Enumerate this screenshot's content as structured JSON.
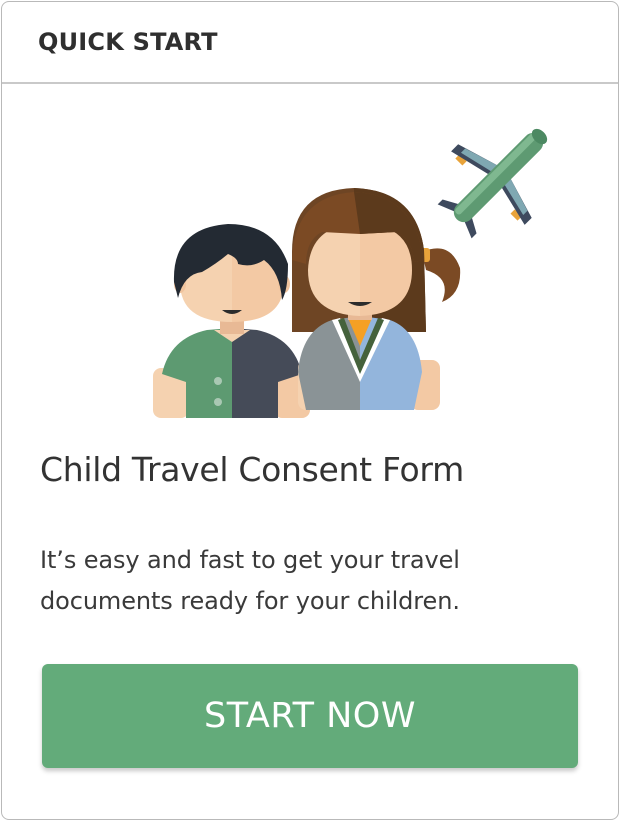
{
  "header": {
    "title": "QUICK START"
  },
  "content": {
    "form_title": "Child Travel Consent Form",
    "description_line1": "It’s easy and fast to get your travel",
    "description_line2": "documents ready for your children."
  },
  "actions": {
    "start_label": "START NOW"
  },
  "illustration": {
    "icons": [
      "boy-icon",
      "girl-icon",
      "airplane-icon"
    ]
  },
  "colors": {
    "accent_green": "#63ab7a",
    "border": "#b9b9b9",
    "text_dark": "#333333"
  }
}
